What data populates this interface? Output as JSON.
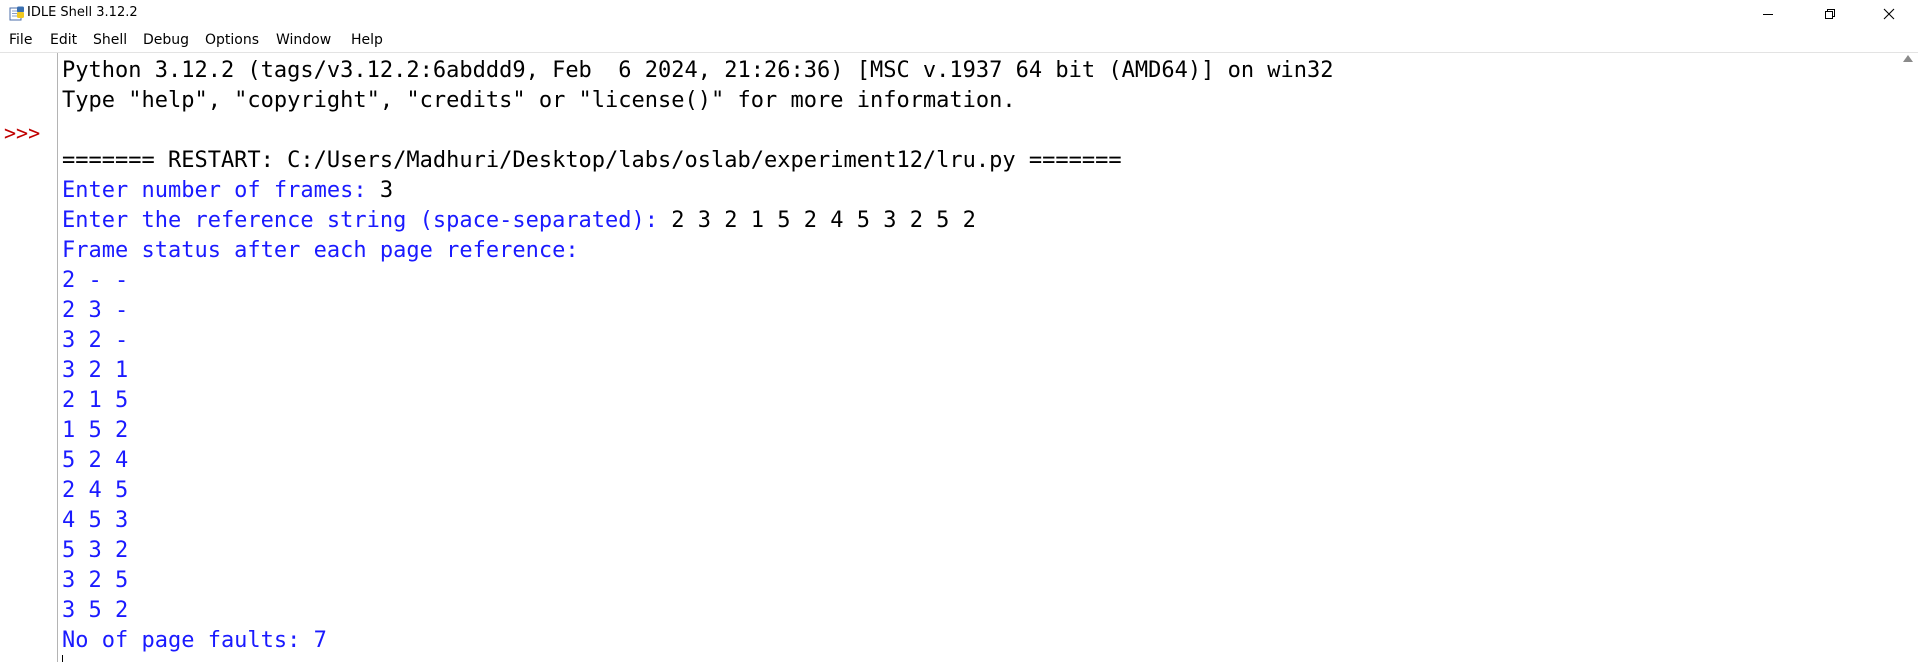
{
  "titlebar": {
    "title": "IDLE Shell 3.12.2",
    "app_icon": "idle-python-icon",
    "minimize_icon": "minimize-icon",
    "maximize_icon": "restore-icon",
    "close_icon": "close-icon"
  },
  "menubar": {
    "items": [
      "File",
      "Edit",
      "Shell",
      "Debug",
      "Options",
      "Window",
      "Help"
    ]
  },
  "shell": {
    "prompt": ">>>",
    "banner_1": "Python 3.12.2 (tags/v3.12.2:6abddd9, Feb  6 2024, 21:26:36) [MSC v.1937 64 bit (AMD64)] on win32",
    "banner_2": "Type \"help\", \"copyright\", \"credits\" or \"license()\" for more information.",
    "restart": "======= RESTART: C:/Users/Madhuri/Desktop/labs/oslab/experiment12/lru.py =======",
    "frames_prompt": "Enter number of frames: ",
    "frames_value": "3",
    "ref_prompt": "Enter the reference string (space-separated): ",
    "ref_value": "2 3 2 1 5 2 4 5 3 2 5 2",
    "status_header": "Frame status after each page reference:",
    "frame_rows": [
      "2 - -",
      "2 3 -",
      "3 2 -",
      "3 2 1",
      "2 1 5",
      "1 5 2",
      "5 2 4",
      "2 4 5",
      "4 5 3",
      "5 3 2",
      "3 2 5",
      "3 5 2"
    ],
    "faults_line": "No of page faults: 7"
  },
  "colors": {
    "stdout": "#1a1aff",
    "prompt": "#c00000",
    "stdin": "#000000"
  }
}
